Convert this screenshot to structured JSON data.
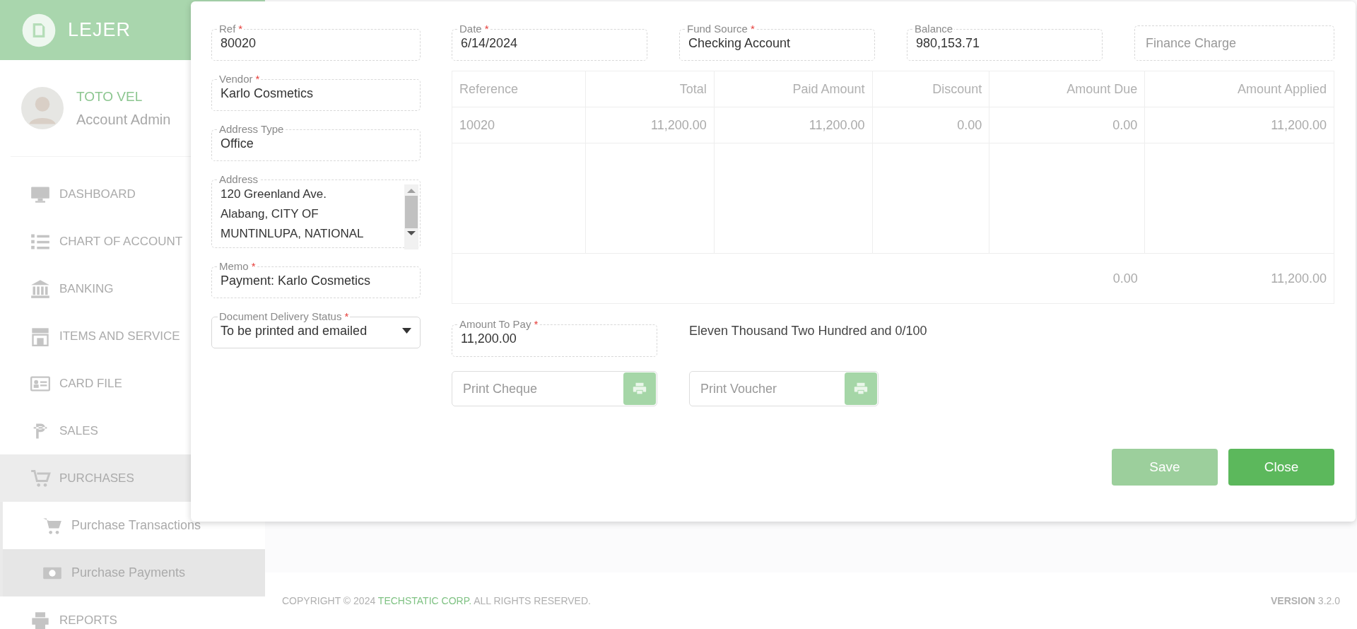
{
  "sidebar": {
    "brand": "LEJER",
    "user": {
      "name": "TOTO VEL",
      "role": "Account Admin"
    },
    "items": [
      {
        "label": "DASHBOARD",
        "selected": false
      },
      {
        "label": "CHART OF ACCOUNT",
        "selected": false
      },
      {
        "label": "BANKING",
        "selected": false
      },
      {
        "label": "ITEMS AND SERVICE",
        "selected": false
      },
      {
        "label": "CARD FILE",
        "selected": false
      },
      {
        "label": "SALES",
        "selected": false
      },
      {
        "label": "PURCHASES",
        "selected": true,
        "children": [
          {
            "label": "Purchase Transactions",
            "selected": false
          },
          {
            "label": "Purchase Payments",
            "selected": true
          }
        ]
      },
      {
        "label": "REPORTS",
        "selected": false
      }
    ]
  },
  "footer": {
    "copyright": "COPYRIGHT © 2024 ",
    "company": "TECHSTATIC CORP.",
    "rights": " ALL RIGHTS RESERVED.",
    "version": "**VERSION** 3.2.0"
  },
  "dialog": {
    "left_fields": [
      {
        "kind": "text",
        "label": "Ref",
        "required_mark": "*",
        "value": "80020"
      },
      {
        "kind": "text",
        "label": "Vendor",
        "required_mark": "*",
        "value": "Karlo Cosmetics"
      },
      {
        "kind": "text",
        "label": "Address Type",
        "value": "Office"
      },
      {
        "kind": "textarea",
        "label": "Address",
        "lines": [
          "120 Greenland Ave.",
          "Alabang, CITY OF",
          "MUNTINLUPA, NATIONAL"
        ]
      },
      {
        "kind": "text",
        "label": "Memo",
        "required_mark": "*",
        "value": "Payment: Karlo Cosmetics"
      },
      {
        "kind": "select",
        "label": "Document Delivery Status",
        "required_mark": "*",
        "value": "To be printed and emailed"
      }
    ],
    "top_fields": [
      {
        "label": "Date",
        "required_mark": "*",
        "value": "6/14/2024"
      },
      {
        "label": "Fund Source",
        "required_mark": "*",
        "value": "Checking Account"
      },
      {
        "label": "Balance",
        "value": "980,153.71"
      },
      {
        "placeholder": "Finance Charge"
      }
    ],
    "table": {
      "columns": [
        "Reference",
        "Total",
        "Paid Amount",
        "Discount",
        "Amount Due",
        "Amount Applied"
      ],
      "rows": [
        [
          "10020",
          "11,200.00",
          "11,200.00",
          "0.00",
          "0.00",
          "11,200.00"
        ]
      ],
      "totals": [
        "0.00",
        "11,200.00"
      ]
    },
    "amount_to_pay": {
      "label": "Amount To Pay",
      "required_mark": "*",
      "value": "11,200.00"
    },
    "amount_in_words": "Eleven Thousand Two Hundred and 0/100",
    "print_fields": [
      {
        "placeholder": "Print Cheque"
      },
      {
        "placeholder": "Print Voucher"
      }
    ],
    "buttons": [
      {
        "label": "Save",
        "disabled": true
      },
      {
        "label": "Close",
        "disabled": false
      }
    ]
  }
}
